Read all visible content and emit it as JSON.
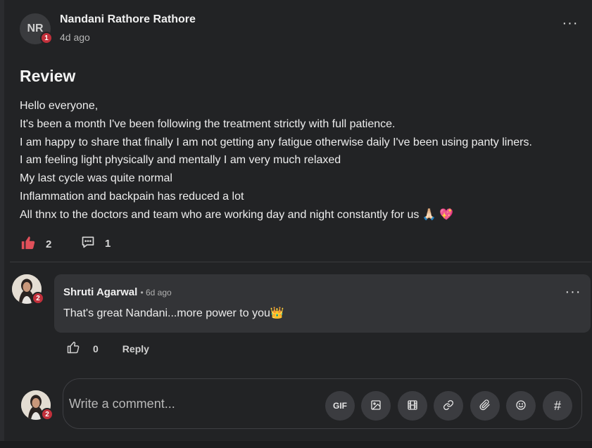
{
  "post": {
    "author_initials": "NR",
    "author_badge": "1",
    "author_name": "Nandani Rathore Rathore",
    "time": "4d ago",
    "title": "Review",
    "body_lines": [
      "Hello everyone,",
      "It's been a month I've been following the treatment strictly with full patience.",
      "I am happy to share that finally I am not getting any fatigue otherwise daily I've been using panty liners.",
      "I am feeling light physically and mentally I am very much relaxed",
      "My last cycle was quite normal",
      "Inflammation and backpain has reduced a lot",
      "All thnx to the doctors and team who are working day and night constantly for us 🙏🏻 💖"
    ],
    "likes": "2",
    "comments": "1",
    "more_label": "···"
  },
  "comment": {
    "author_badge": "2",
    "author_name": "Shruti Agarwal",
    "meta": "• 6d ago",
    "text": "That's great Nandani...more power to you👑",
    "likes": "0",
    "reply_label": "Reply",
    "more_label": "···"
  },
  "composer": {
    "avatar_badge": "2",
    "placeholder": "Write a comment...",
    "gif_label": "GIF",
    "hash_label": "#"
  },
  "colors": {
    "background": "#222325",
    "bubble": "#333437",
    "badge": "#c2303b",
    "like_active": "#e0505a"
  }
}
